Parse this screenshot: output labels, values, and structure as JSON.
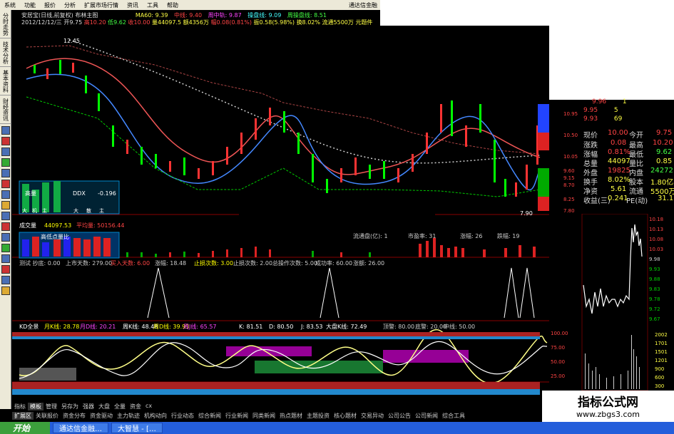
{
  "menu": [
    "系统",
    "功能",
    "报价",
    "分析",
    "扩展市场行情",
    "资讯",
    "工具",
    "帮助"
  ],
  "window_title": "通达信金融",
  "left_tabs": [
    "分时走势",
    "技术分析",
    "基本资料",
    "财经资讯"
  ],
  "header": {
    "line1": "安居宝(日线,前复权) 布林主图",
    "ma60": "MA60: 9.39",
    "zhongxian": "中线: 9.40",
    "zhoushang": "周中轨: 9.87",
    "tupo": "操盘线: 9.09",
    "zhoushangxian": "周操盘线: 8.51",
    "line2_date": "2012/12/12/三",
    "open": "开9.75",
    "high": "高10.20",
    "low": "低9.62",
    "close": "收10.00",
    "vol": "量44097.5",
    "amount": "额4356万",
    "change": "幅0.08(0.81%)",
    "amp": "振0.58(5.98%)",
    "turn": "换8.02%",
    "float": "流通5500万",
    "unit": "元题件",
    "mark_high": "12.45",
    "mark_low": "7.90"
  },
  "indicator_box": {
    "label1": "高量",
    "ddx_label": "DDX",
    "ddx_value": "-0.196",
    "row_labels": [
      "大",
      "机",
      "主",
      "大",
      "散",
      "主"
    ]
  },
  "vol_header": {
    "title": "成交量",
    "value": "44097.53",
    "ma": "平均量: 50156.44",
    "circ_label": "流通盘(亿): 1",
    "pe_label": "市盈率: 31",
    "up_label": "涨幅: 26",
    "down_label": "跌幅: 19",
    "mini_box": "高低点量比"
  },
  "test_header": {
    "items": [
      "测试 抄底: 0.00",
      "上市天数: 279.00",
      "买入天数: 6.00",
      "涨幅: 18.48",
      "止损次数: 3.00",
      "止损次数: 2.00",
      "总操作次数: 5.00",
      "成功率: 60.00",
      "涨额: 26.00"
    ]
  },
  "kd_header": {
    "items": [
      "KD全景",
      "月K线: 28.78",
      "月D线: 20.21",
      "周K线: 48.48",
      "周D线: 39.93",
      "周J线: 65.57",
      "K: 81.51",
      "D: 80.50",
      "J: 83.53",
      "大盘K线: 72.49",
      "顶警: 80.00",
      "底警: 20.00",
      "中线: 50.00"
    ]
  },
  "bottom_tabs": [
    "指标",
    "模板",
    "管理",
    "另存为",
    "强器",
    "大盘",
    "全量",
    "资金",
    "cx"
  ],
  "bottom_tabs2": [
    "扩展区",
    "关联报价",
    "资金分布",
    "资金驱动",
    "主力轨迹",
    "机构动向",
    "行业动态",
    "综合新闻",
    "行业新闻",
    "同类新闻",
    "热点题材",
    "主题投资",
    "核心题材",
    "交易异动",
    "公司公告",
    "公司新闻",
    "综合工具"
  ],
  "price_axis": [
    "10.95",
    "10.50",
    "10.05",
    "9.60",
    "9.15",
    "8.70",
    "8.25",
    "7.80"
  ],
  "order_book": [
    {
      "p": "9.96",
      "v": "1"
    },
    {
      "p": "9.95",
      "v": "5"
    },
    {
      "p": "9.93",
      "v": "69"
    }
  ],
  "quotes": [
    {
      "l": "现价",
      "v": "10.00",
      "l2": "今开",
      "v2": "9.75"
    },
    {
      "l": "涨跌",
      "v": "0.08",
      "l2": "最高",
      "v2": "10.20"
    },
    {
      "l": "涨幅",
      "v": "0.81%",
      "l2": "最低",
      "v2": "9.62"
    },
    {
      "l": "总量",
      "v": "44097",
      "l2": "量比",
      "v2": "0.85"
    },
    {
      "l": "外盘",
      "v": "19825",
      "l2": "内盘",
      "v2": "24272"
    },
    {
      "l": "换手",
      "v": "8.02%",
      "l2": "股本",
      "v2": "1.80亿"
    },
    {
      "l": "净资",
      "v": "5.61",
      "l2": "流通",
      "v2": "5500万"
    },
    {
      "l": "收益(三)",
      "v": "0.241",
      "l2": "PE(动)",
      "v2": "31.1"
    }
  ],
  "minute_axis": [
    "10.18",
    "10.13",
    "10.08",
    "10.03",
    "9.98",
    "9.93",
    "9.88",
    "9.83",
    "9.78",
    "9.72",
    "9.67"
  ],
  "minute_vol_axis": [
    "2002",
    "1701",
    "1501",
    "1201",
    "900",
    "600",
    "300"
  ],
  "kd_axis": [
    "100.00",
    "75.00",
    "50.00",
    "25.00"
  ],
  "watermark": {
    "t1": "指标公式网",
    "t2": "www.zbgs3.com"
  },
  "taskbar": {
    "start": "开始",
    "tasks": [
      "通达信金融…",
      "大智慧 - […"
    ]
  }
}
